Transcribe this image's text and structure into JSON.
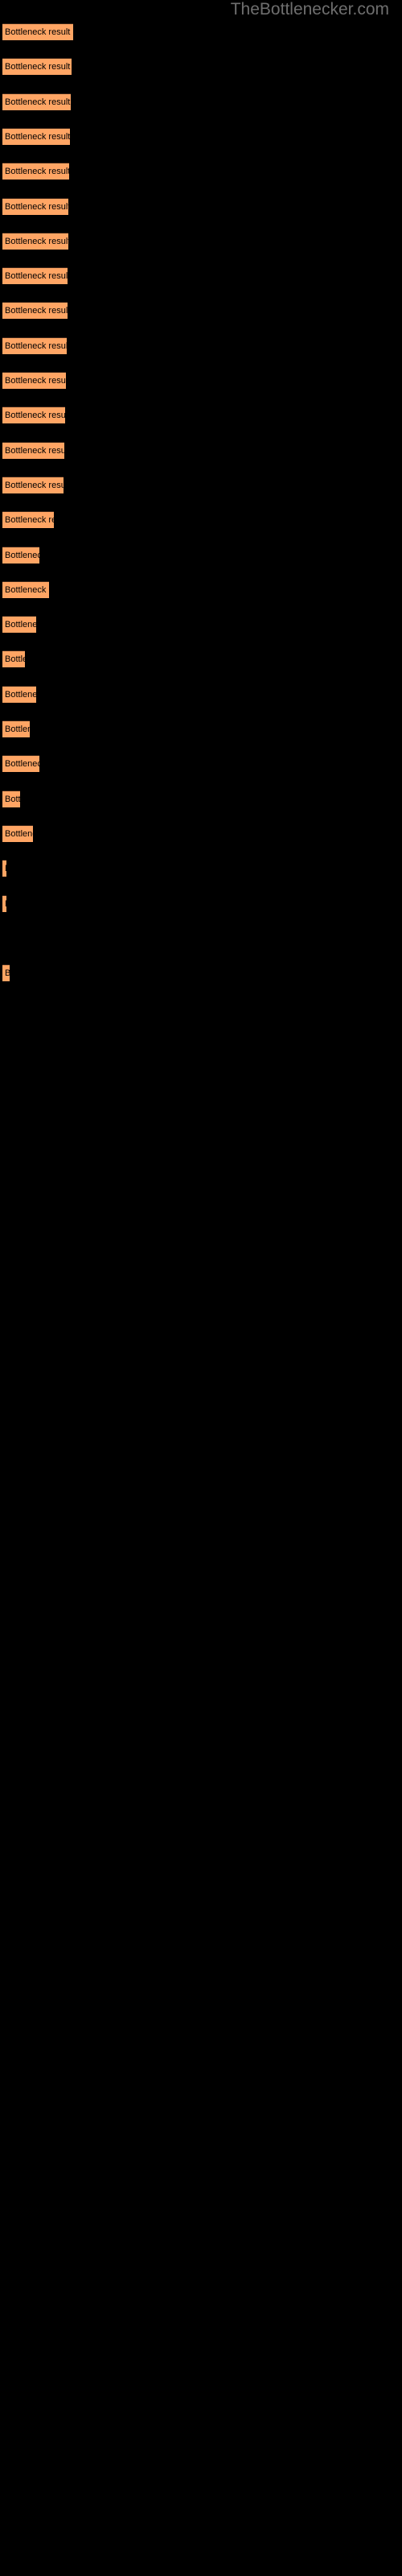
{
  "watermark": "TheBottlenecker.com",
  "colors": {
    "background": "#000000",
    "bar_fill": "#ffa564",
    "bar_edge": "#3b2517",
    "bar_text": "#000000",
    "watermark_text": "#6e6e6e"
  },
  "chart_data": {
    "type": "bar",
    "orientation": "horizontal",
    "title": "",
    "subtitle": "",
    "xlabel": "",
    "ylabel": "",
    "grid": false,
    "legend": null,
    "axis_visible": false,
    "tick_labels_visible": false,
    "bar_label_text": "Bottleneck result",
    "xlim": [
      0,
      500
    ],
    "categories": [
      "Bottleneck result",
      "Bottleneck result",
      "Bottleneck result",
      "Bottleneck result",
      "Bottleneck result",
      "Bottleneck result",
      "Bottleneck result",
      "Bottleneck result",
      "Bottleneck result",
      "Bottleneck result",
      "Bottleneck result",
      "Bottleneck result",
      "Bottleneck result",
      "Bottleneck result",
      "Bottleneck result",
      "Bottleneck result",
      "Bottleneck result",
      "Bottleneck result",
      "Bottleneck result",
      "Bottleneck result",
      "Bottleneck result",
      "Bottleneck result",
      "Bottleneck result",
      "Bottleneck result",
      "Bottleneck result",
      "Bottleneck result",
      "Bottleneck result",
      "Bottleneck result"
    ],
    "values": [
      88,
      86,
      85,
      84,
      83,
      82,
      82,
      81,
      81,
      80,
      79,
      78,
      77,
      76,
      64,
      46,
      58,
      42,
      28,
      42,
      34,
      46,
      22,
      38,
      5,
      5,
      0,
      9
    ],
    "bars": [
      {
        "index": 1,
        "label": "Bottleneck result",
        "width": 88,
        "y": 29
      },
      {
        "index": 2,
        "label": "Bottleneck result",
        "width": 86,
        "y": 72
      },
      {
        "index": 3,
        "label": "Bottleneck result",
        "width": 85,
        "y": 115
      },
      {
        "index": 4,
        "label": "Bottleneck result",
        "width": 84,
        "y": 158
      },
      {
        "index": 5,
        "label": "Bottleneck result",
        "width": 83,
        "y": 201
      },
      {
        "index": 6,
        "label": "Bottleneck result",
        "width": 82,
        "y": 244
      },
      {
        "index": 7,
        "label": "Bottleneck result",
        "width": 82,
        "y": 287
      },
      {
        "index": 8,
        "label": "Bottleneck result",
        "width": 81,
        "y": 331
      },
      {
        "index": 9,
        "label": "Bottleneck result",
        "width": 81,
        "y": 374
      },
      {
        "index": 10,
        "label": "Bottleneck result",
        "width": 80,
        "y": 417
      },
      {
        "index": 11,
        "label": "Bottleneck result",
        "width": 79,
        "y": 460
      },
      {
        "index": 12,
        "label": "Bottleneck result",
        "width": 78,
        "y": 503
      },
      {
        "index": 13,
        "label": "Bottleneck result",
        "width": 77,
        "y": 547
      },
      {
        "index": 14,
        "label": "Bottleneck result",
        "width": 76,
        "y": 590
      },
      {
        "index": 15,
        "label": "Bottleneck result",
        "width": 64,
        "y": 633
      },
      {
        "index": 16,
        "label": "Bottleneck result",
        "width": 46,
        "y": 676
      },
      {
        "index": 17,
        "label": "Bottleneck result",
        "width": 58,
        "y": 719
      },
      {
        "index": 18,
        "label": "Bottleneck result",
        "width": 42,
        "y": 763
      },
      {
        "index": 19,
        "label": "Bottleneck result",
        "width": 28,
        "y": 806
      },
      {
        "index": 20,
        "label": "Bottleneck result",
        "width": 42,
        "y": 849
      },
      {
        "index": 21,
        "label": "Bottleneck result",
        "width": 34,
        "y": 892
      },
      {
        "index": 22,
        "label": "Bottleneck result",
        "width": 46,
        "y": 936
      },
      {
        "index": 23,
        "label": "Bottleneck result",
        "width": 22,
        "y": 979
      },
      {
        "index": 24,
        "label": "Bottleneck result",
        "width": 38,
        "y": 1022
      },
      {
        "index": 25,
        "label": "Bottleneck result",
        "width": 5,
        "y": 1065
      },
      {
        "index": 26,
        "label": "Bottleneck result",
        "width": 5,
        "y": 1238
      },
      {
        "index": 27,
        "label": "Bottleneck result",
        "width": 9,
        "y": 1238
      }
    ]
  }
}
